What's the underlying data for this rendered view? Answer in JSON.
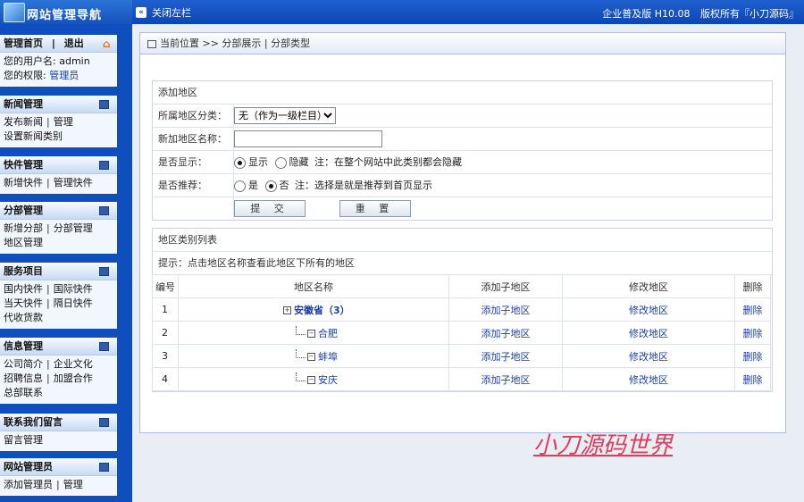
{
  "topbar": {
    "logo_title": "网站管理导航",
    "close_left_label": "关闭左栏",
    "version_text": "企业普及版  H10.08",
    "copyright_text": "版权所有『小刀源码』"
  },
  "sidebar": {
    "home": {
      "title_home": "管理首页",
      "title_logout": "退出",
      "user_label": "您的用户名:",
      "user_value": "admin",
      "perm_label": "您的权限:",
      "perm_value": "管理员"
    },
    "groups": [
      {
        "title": "新闻管理",
        "lines": [
          [
            "发布新闻",
            "管理"
          ],
          [
            "设置新闻类别"
          ]
        ]
      },
      {
        "title": "快件管理",
        "lines": [
          [
            "新增快件",
            "管理快件"
          ]
        ]
      },
      {
        "title": "分部管理",
        "lines": [
          [
            "新增分部",
            "分部管理"
          ],
          [
            "地区管理"
          ]
        ]
      },
      {
        "title": "服务项目",
        "lines": [
          [
            "国内快件",
            "国际快件"
          ],
          [
            "当天快件",
            "隔日快件"
          ],
          [
            "代收货款"
          ]
        ]
      },
      {
        "title": "信息管理",
        "lines": [
          [
            "公司简介",
            "企业文化"
          ],
          [
            "招聘信息",
            "加盟合作"
          ],
          [
            "总部联系"
          ]
        ]
      },
      {
        "title": "联系我们留言",
        "lines": [
          [
            "留言管理"
          ]
        ]
      },
      {
        "title": "网站管理员",
        "lines": [
          [
            "添加管理员",
            "管理"
          ]
        ]
      }
    ]
  },
  "main": {
    "breadcrumb": "当前位置 >> 分部展示 | 分部类型",
    "add_panel": {
      "title": "添加地区",
      "parent_label": "所属地区分类：",
      "parent_selected": "无（作为一级栏目）",
      "name_label": "新加地区名称：",
      "name_value": "",
      "show_label": "是否显示：",
      "show_yes": "显示",
      "show_no": "隐藏",
      "show_note": "注：在整个网站中此类别都会隐藏",
      "recommend_label": "是否推荐：",
      "recommend_yes": "是",
      "recommend_no": "否",
      "recommend_note": "注：选择是就是推荐到首页显示",
      "submit_label": "提 交",
      "reset_label": "重 置"
    },
    "list_panel": {
      "title": "地区类别列表",
      "hint": "提示：点击地区名称查看此地区下所有的地区",
      "headers": [
        "编号",
        "地区名称",
        "添加子地区",
        "修改地区",
        "删除"
      ],
      "rows": [
        {
          "id": "1",
          "name": "安徽省（3）",
          "add": "添加子地区",
          "edit": "修改地区",
          "del": "删除"
        },
        {
          "id": "2",
          "name": "合肥",
          "add": "添加子地区",
          "edit": "修改地区",
          "del": "删除"
        },
        {
          "id": "3",
          "name": "蚌埠",
          "add": "添加子地区",
          "edit": "修改地区",
          "del": "删除"
        },
        {
          "id": "4",
          "name": "安庆",
          "add": "添加子地区",
          "edit": "修改地区",
          "del": "删除"
        }
      ]
    }
  },
  "watermark": "小刀源码世界"
}
